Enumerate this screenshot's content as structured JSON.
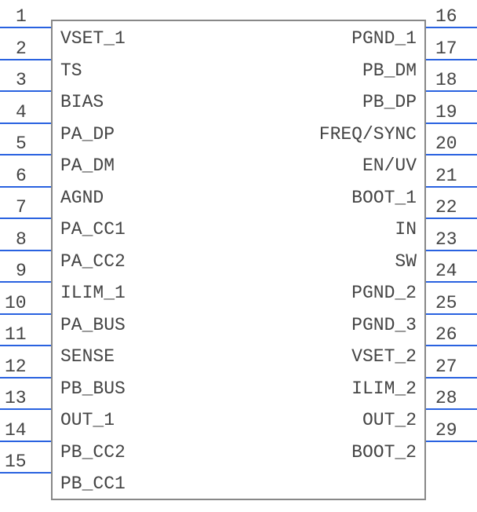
{
  "chip": {
    "left_pins": [
      {
        "num": "1",
        "label": "VSET_1"
      },
      {
        "num": "2",
        "label": "TS"
      },
      {
        "num": "3",
        "label": "BIAS"
      },
      {
        "num": "4",
        "label": "PA_DP"
      },
      {
        "num": "5",
        "label": "PA_DM"
      },
      {
        "num": "6",
        "label": "AGND"
      },
      {
        "num": "7",
        "label": "PA_CC1"
      },
      {
        "num": "8",
        "label": "PA_CC2"
      },
      {
        "num": "9",
        "label": "ILIM_1"
      },
      {
        "num": "10",
        "label": "PA_BUS"
      },
      {
        "num": "11",
        "label": "SENSE"
      },
      {
        "num": "12",
        "label": "PB_BUS"
      },
      {
        "num": "13",
        "label": "OUT_1"
      },
      {
        "num": "14",
        "label": "PB_CC2"
      },
      {
        "num": "15",
        "label": "PB_CC1"
      }
    ],
    "right_pins": [
      {
        "num": "16",
        "label": "PGND_1"
      },
      {
        "num": "17",
        "label": "PB_DM"
      },
      {
        "num": "18",
        "label": "PB_DP"
      },
      {
        "num": "19",
        "label": "FREQ/SYNC"
      },
      {
        "num": "20",
        "label": "EN/UV"
      },
      {
        "num": "21",
        "label": "BOOT_1"
      },
      {
        "num": "22",
        "label": "IN"
      },
      {
        "num": "23",
        "label": "SW"
      },
      {
        "num": "24",
        "label": "PGND_2"
      },
      {
        "num": "25",
        "label": "PGND_3"
      },
      {
        "num": "26",
        "label": "VSET_2"
      },
      {
        "num": "27",
        "label": "ILIM_2"
      },
      {
        "num": "28",
        "label": "OUT_2"
      },
      {
        "num": "29",
        "label": "BOOT_2"
      }
    ]
  }
}
